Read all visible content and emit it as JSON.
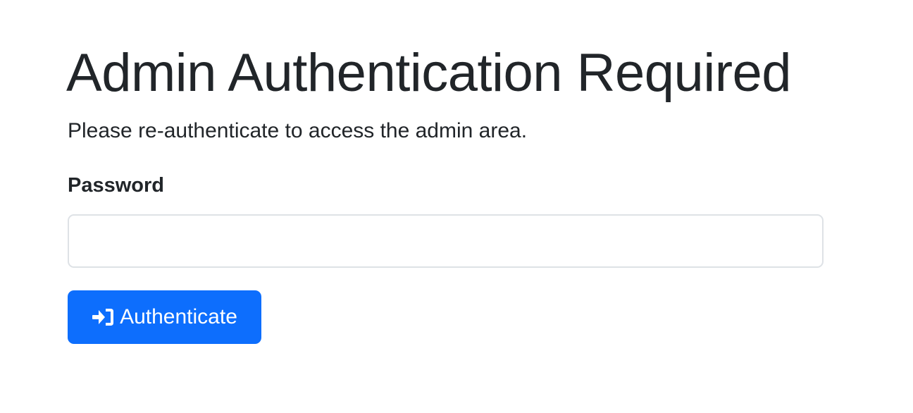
{
  "page": {
    "title": "Admin Authentication Required",
    "lead": "Please re-authenticate to access the admin area."
  },
  "form": {
    "password_label": "Password",
    "password_value": "",
    "password_placeholder": "",
    "submit_label": "Authenticate",
    "submit_icon": "box-arrow-in-right-icon"
  },
  "colors": {
    "primary": "#0d6efd",
    "text": "#212529",
    "input_border": "#dee2e6"
  }
}
